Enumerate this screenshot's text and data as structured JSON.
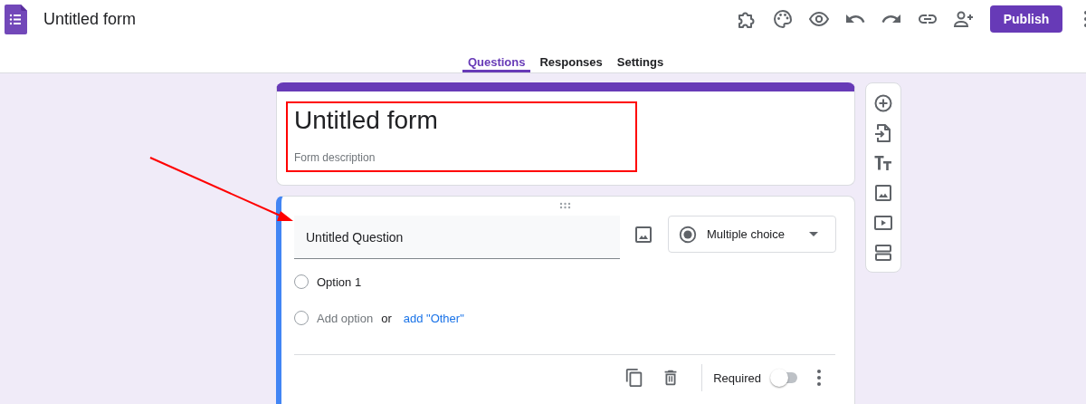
{
  "header": {
    "title": "Untitled form",
    "publish_button": "Publish"
  },
  "tabs": [
    {
      "label": "Questions",
      "selected": true
    },
    {
      "label": "Responses",
      "selected": false
    },
    {
      "label": "Settings",
      "selected": false
    }
  ],
  "form_header": {
    "title": "Untitled form",
    "description_placeholder": "Form description"
  },
  "question": {
    "title": "Untitled Question",
    "type": "Multiple choice",
    "options": [
      {
        "label": "Option 1",
        "checked": false
      }
    ],
    "add_option": {
      "label": "Add option",
      "checked": false
    },
    "or": "or",
    "add_other": "add \"Other\"",
    "required_label": "Required",
    "required": false
  }
}
